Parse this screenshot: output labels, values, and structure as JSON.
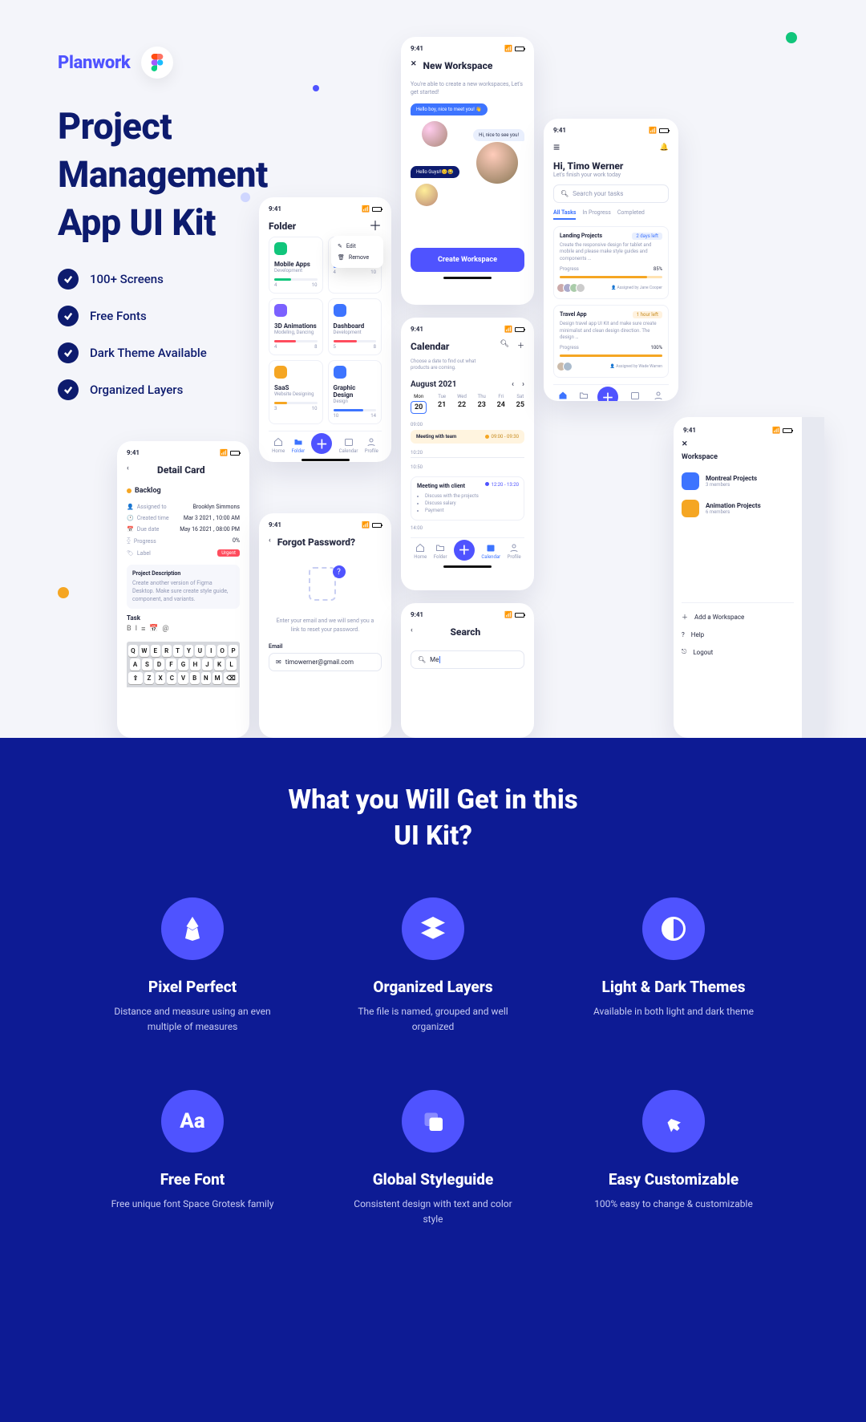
{
  "hero": {
    "brand": "Planwork",
    "headline_l1": "Project",
    "headline_l2": "Management",
    "headline_l3": "App UI Kit",
    "checks": [
      "100+ Screens",
      "Free Fonts",
      "Dark Theme Available",
      "Organized Layers"
    ]
  },
  "screens": {
    "time": "9:41",
    "folder": {
      "title": "Folder",
      "menu": {
        "edit": "Edit",
        "remove": "Remove"
      },
      "cards": [
        {
          "title": "Mobile Apps",
          "sub": "Development",
          "color": "#11c57b",
          "barColor": "#11c57b",
          "pct": 40,
          "done": "4",
          "total": "10"
        },
        {
          "title": "",
          "sub": "",
          "color": "#3d74ff",
          "barColor": "#3d74ff",
          "pct": 60,
          "done": "4",
          "total": "10"
        },
        {
          "title": "3D Animations",
          "sub": "Modeling, Dancing",
          "color": "#7b61ff",
          "barColor": "#ff4d5e",
          "pct": 50,
          "done": "4",
          "total": "8"
        },
        {
          "title": "Dashboard",
          "sub": "Development",
          "color": "#3d74ff",
          "barColor": "#ff4d5e",
          "pct": 55,
          "done": "5",
          "total": "8"
        },
        {
          "title": "SaaS",
          "sub": "Website Designing",
          "color": "#f5a623",
          "barColor": "#f5a623",
          "pct": 30,
          "done": "3",
          "total": "10"
        },
        {
          "title": "Graphic Design",
          "sub": "Design",
          "color": "#3d74ff",
          "barColor": "#3d74ff",
          "pct": 70,
          "done": "10",
          "total": "14"
        }
      ],
      "nav": [
        "Home",
        "Folder",
        "",
        "Calendar",
        "Profile"
      ]
    },
    "detail": {
      "title": "Detail Card",
      "heading": "Backlog",
      "rows": {
        "assigned_lbl": "Assigned to",
        "assigned_val": "Brooklyn Simmons",
        "created_lbl": "Created time",
        "created_val": "Mar 3 2021 , 10:00 AM",
        "due_lbl": "Due date",
        "due_val": "May 16 2021 , 08:00 PM",
        "progress_lbl": "Progress",
        "progress_val": "0%",
        "label_lbl": "Label"
      },
      "tag": "Urgent",
      "desc_title": "Project  Description",
      "desc_body": "Create another version of Figma Desktop. Make sure create style guide, component, and variants.",
      "task_title": "Task",
      "kbd": {
        "r1": [
          "Q",
          "W",
          "E",
          "R",
          "T",
          "Y",
          "U",
          "I",
          "O",
          "P"
        ],
        "r2": [
          "A",
          "S",
          "D",
          "F",
          "G",
          "H",
          "J",
          "K",
          "L"
        ],
        "r3": [
          "⇧",
          "Z",
          "X",
          "C",
          "V",
          "B",
          "N",
          "M",
          "⌫"
        ]
      }
    },
    "forgot": {
      "title": "Forgot Password?",
      "body": "Enter your email and we will send you a link to reset your password.",
      "email_lbl": "Email",
      "email_val": "timowerner@gmail.com"
    },
    "workspace": {
      "title": "New Workspace",
      "subtitle": "You're able to create a new workspaces, Let's get started!",
      "bubble1": "Hello boy, nice to meet you! 👋",
      "bubble2": "Hi, nice to see you!",
      "bubble3": "Hello Guys!!😊😂",
      "cta": "Create Workspace"
    },
    "calendar": {
      "title": "Calendar",
      "sub": "Choose a date to find out what products are coming.",
      "month": "August 2021",
      "days": [
        {
          "d": "Mon",
          "n": "20"
        },
        {
          "d": "Tue",
          "n": "21"
        },
        {
          "d": "Wed",
          "n": "22"
        },
        {
          "d": "Thu",
          "n": "23"
        },
        {
          "d": "Fri",
          "n": "24"
        },
        {
          "d": "Sat",
          "n": "25"
        }
      ],
      "ev1_time": "09:00",
      "ev1": "Meeting with team",
      "ev1t": "09:00 - 09:30",
      "t2": "10:20",
      "t3": "10:50",
      "ev2": "Meeting with client",
      "ev2t": "12:20 - 13:20",
      "ev2_bullets": [
        "Discuss with the projects",
        "Discuss salary",
        "Payment"
      ],
      "t4": "14:00"
    },
    "home": {
      "greet": "Hi, Timo Werner",
      "sub": "Let's finish your work today",
      "search_ph": "Search your tasks",
      "tabs": [
        "All Tasks",
        "In Progress",
        "Completed"
      ],
      "card1_title": "Landing Projects",
      "card1_badge": "2 days left",
      "card1_body": "Create the responsive design for tablet and mobile and please make style guides and components …",
      "card1_prog": "Progress",
      "card1_pct": "85%",
      "card1_assign": "Assigned by Jane Cooper",
      "card2_title": "Travel App",
      "card2_badge": "1 hour left",
      "card2_body": "Design travel app UI Kit and make sure create minimalist and clean design direction. The design …",
      "card2_prog": "Progress",
      "card2_pct": "100%",
      "card2_assign": "Assigned by Wade Warren"
    },
    "search": {
      "title": "Search",
      "query": "Me"
    },
    "drawer": {
      "title": "Workspace",
      "items": [
        {
          "name": "Montreal Projects",
          "sub": "3 members",
          "color": "#3d74ff"
        },
        {
          "name": "Animation Projects",
          "sub": "6 members",
          "color": "#f5a623"
        }
      ],
      "actions": [
        "Add a Workspace",
        "Help",
        "Logout"
      ]
    }
  },
  "get": {
    "title_l1": "What you Will Get in this",
    "title_l2": "UI Kit?",
    "features": [
      {
        "title": "Pixel Perfect",
        "body": "Distance and measure using an even multiple of measures"
      },
      {
        "title": "Organized Layers",
        "body": "The file is named, grouped and well organized"
      },
      {
        "title": "Light & Dark Themes",
        "body": "Available in both light and dark theme"
      },
      {
        "title": "Free Font",
        "body": "Free unique font Space Grotesk family"
      },
      {
        "title": "Global Styleguide",
        "body": "Consistent design with text and color style"
      },
      {
        "title": "Easy Customizable",
        "body": "100% easy to change & customizable"
      }
    ]
  }
}
